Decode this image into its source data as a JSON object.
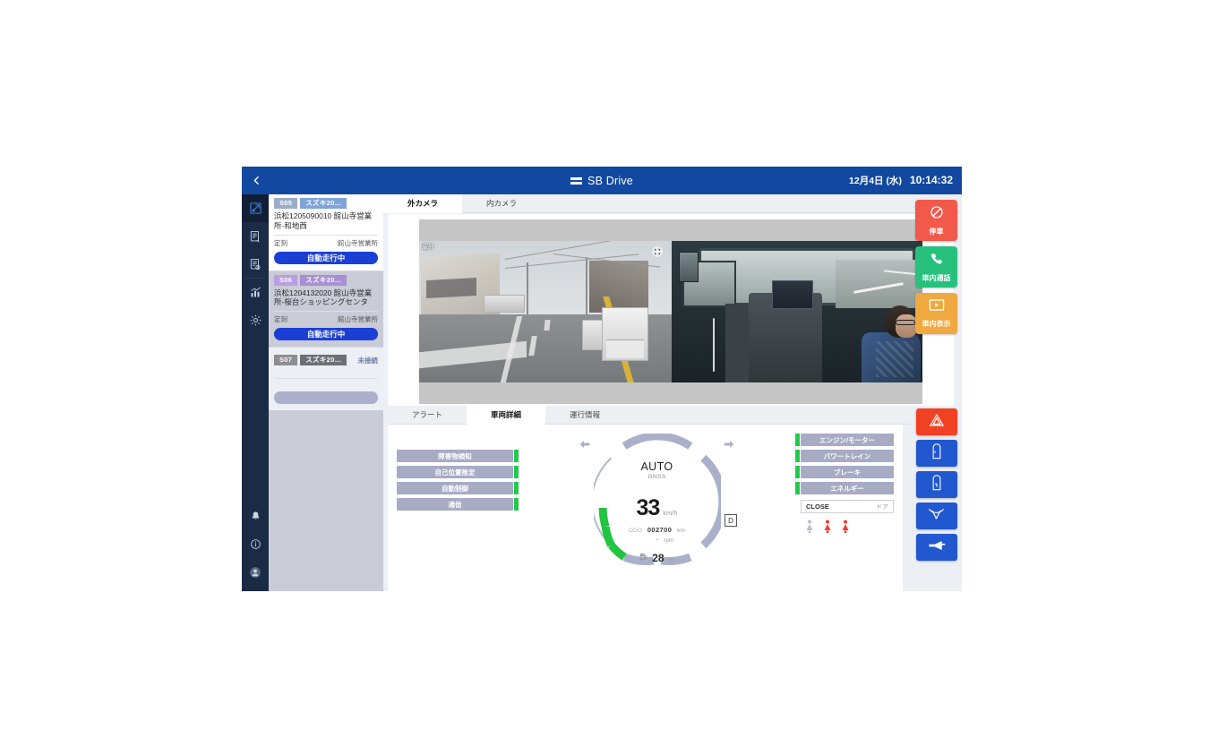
{
  "topbar": {
    "back_icon": "chevron-left-icon",
    "brand": "SB Drive",
    "brand_prefix": "SB",
    "brand_suffix": "Drive",
    "date": "12月4日 (水)",
    "time": "10:14:32"
  },
  "rail": {
    "items": [
      {
        "name": "map-route-icon",
        "active": true
      },
      {
        "name": "schedule-doc-icon",
        "active": false
      },
      {
        "name": "history-doc-icon",
        "active": false
      },
      {
        "name": "analytics-chart-icon",
        "active": false
      },
      {
        "name": "settings-gear-icon",
        "active": false
      }
    ],
    "bottom_items": [
      {
        "name": "bell-icon"
      },
      {
        "name": "info-icon"
      },
      {
        "name": "user-avatar-icon"
      }
    ]
  },
  "vehicle_list": [
    {
      "id_tag": "S05",
      "model_tag": "スズキ20…",
      "name": "浜松1205090010 館山寺営業所-和地西",
      "meta_left": "定刻",
      "meta_right": "館山寺営業所",
      "action": "自動走行中",
      "note": "",
      "selected": false,
      "tag_color": "blue"
    },
    {
      "id_tag": "S06",
      "model_tag": "スズキ20…",
      "name": "浜松1204132020 館山寺営業所-桜台ショッピングセンタ",
      "meta_left": "定刻",
      "meta_right": "館山寺営業所",
      "action": "自動走行中",
      "note": "",
      "selected": true,
      "tag_color": "purple"
    },
    {
      "id_tag": "S07",
      "model_tag": "スズキ20…",
      "name": "",
      "meta_left": "",
      "meta_right": "",
      "action": "",
      "note": "未接続",
      "selected": false,
      "tag_color": "grey"
    }
  ],
  "camera": {
    "tabs": [
      {
        "label": "外カメラ",
        "active": true
      },
      {
        "label": "内カメラ",
        "active": false
      }
    ],
    "outer_label": "車外",
    "badge_icon": "fullscreen-icon"
  },
  "bottom_tabs": [
    {
      "label": "アラート",
      "active": false
    },
    {
      "label": "車両詳細",
      "active": true
    },
    {
      "label": "運行情報",
      "active": false
    }
  ],
  "vehicle_detail": {
    "left_status": [
      {
        "label": "障害物検知",
        "led": "#23c94a"
      },
      {
        "label": "自己位置推定",
        "led": "#23c94a"
      },
      {
        "label": "自動制御",
        "led": "#23c94a"
      },
      {
        "label": "通信",
        "led": "#23c94a"
      }
    ],
    "right_status": [
      {
        "label": "エンジン/モーター",
        "led": "#23c94a"
      },
      {
        "label": "パワートレイン",
        "led": "#23c94a"
      },
      {
        "label": "ブレーキ",
        "led": "#23c94a"
      },
      {
        "label": "エネルギー",
        "led": "#23c94a"
      }
    ],
    "door": {
      "value": "CLOSE",
      "label": "ドア"
    },
    "passengers": [
      {
        "name": "passenger-icon-inactive",
        "color": "#b9bdd6"
      },
      {
        "name": "passenger-icon-active",
        "color": "#f03b2a"
      },
      {
        "name": "passenger-icon-active",
        "color": "#f03b2a"
      }
    ],
    "gauge": {
      "mode": "AUTO",
      "localization": "GNSS",
      "speed": "33",
      "speed_unit": "km/h",
      "gear": "D",
      "odo_label": "ODO",
      "odo_value": "002700",
      "odo_unit": "km",
      "rpm_value": "-",
      "rpm_unit": "rpm",
      "fuel_value": "28",
      "fuel_unit": "%",
      "fuel_icon": "fuel-pump-icon",
      "ring_color": "#aab0ca",
      "fuel_arc_color": "#22c540",
      "arrow_left_icon": "arrow-left-icon",
      "arrow_right_icon": "arrow-right-icon"
    }
  },
  "actions": [
    {
      "icon": "no-entry-stop-icon",
      "label": "停車",
      "style": "stop"
    },
    {
      "icon": "phone-icon",
      "label": "車内通話",
      "style": "call"
    },
    {
      "icon": "display-play-icon",
      "label": "車内表示",
      "style": "disp"
    }
  ],
  "controls": [
    {
      "icon": "hazard-triangle-icon",
      "style": "red"
    },
    {
      "icon": "door-front-open-icon",
      "style": "blue"
    },
    {
      "icon": "door-rear-open-icon",
      "style": "blue"
    },
    {
      "icon": "wiper-icon",
      "style": "blue"
    },
    {
      "icon": "horn-icon",
      "style": "blue"
    }
  ]
}
